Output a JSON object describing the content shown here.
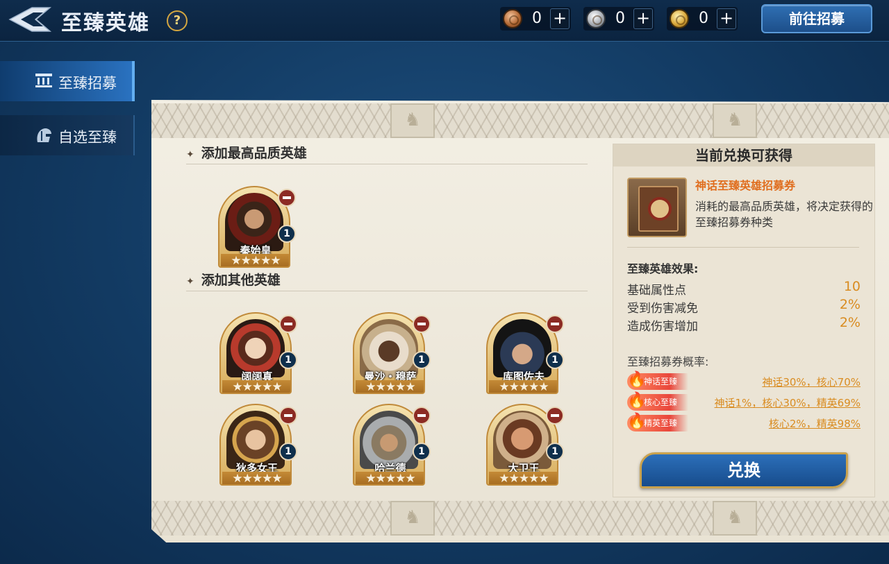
{
  "header": {
    "title": "至臻英雄",
    "currencies": [
      {
        "type": "bronze",
        "value": "0"
      },
      {
        "type": "silver",
        "value": "0"
      },
      {
        "type": "gold",
        "value": "0"
      }
    ],
    "go_recruit_label": "前往招募"
  },
  "sidebar": {
    "items": [
      {
        "label": "至臻招募",
        "icon": "temple-icon",
        "active": true
      },
      {
        "label": "自选至臻",
        "icon": "helmet-icon",
        "active": false
      }
    ]
  },
  "main": {
    "top_section_title": "添加最高品质英雄",
    "other_section_title": "添加其他英雄",
    "top_hero": {
      "name": "秦始皇",
      "stars": "★★★★★",
      "level": "1"
    },
    "other_heroes": [
      {
        "name": "阔阔真",
        "stars": "★★★★★",
        "level": "1"
      },
      {
        "name": "曼沙・穆萨",
        "stars": "★★★★★",
        "level": "1"
      },
      {
        "name": "库图佐夫",
        "stars": "★★★★★",
        "level": "1"
      },
      {
        "name": "狄多女王",
        "stars": "★★★★★",
        "level": "1"
      },
      {
        "name": "哈兰德",
        "stars": "★★★★★",
        "level": "1"
      },
      {
        "name": "大卫王",
        "stars": "★★★★★",
        "level": "1"
      }
    ]
  },
  "info": {
    "header": "当前兑换可获得",
    "ticket_name": "神话至臻英雄招募券",
    "ticket_desc": "消耗的最高品质英雄，将决定获得的至臻招募券种类",
    "effects_title": "至臻英雄效果:",
    "effects": [
      {
        "label": "基础属性点",
        "value": "10"
      },
      {
        "label": "受到伤害减免",
        "value": "2%"
      },
      {
        "label": "造成伤害增加",
        "value": "2%"
      }
    ],
    "prob_title": "至臻招募券概率:",
    "probabilities": [
      {
        "tag": "神话至臻",
        "value": "神话30%，核心70%"
      },
      {
        "tag": "核心至臻",
        "value": "神话1%，核心30%，精英69%"
      },
      {
        "tag": "精英至臻",
        "value": "核心2%，精英98%"
      }
    ],
    "exchange_label": "兑换"
  },
  "colors": {
    "accent_orange": "#d98c21",
    "ticket_name": "#e06e1f",
    "primary_blue": "#2c6fba",
    "background": "#123a62"
  }
}
